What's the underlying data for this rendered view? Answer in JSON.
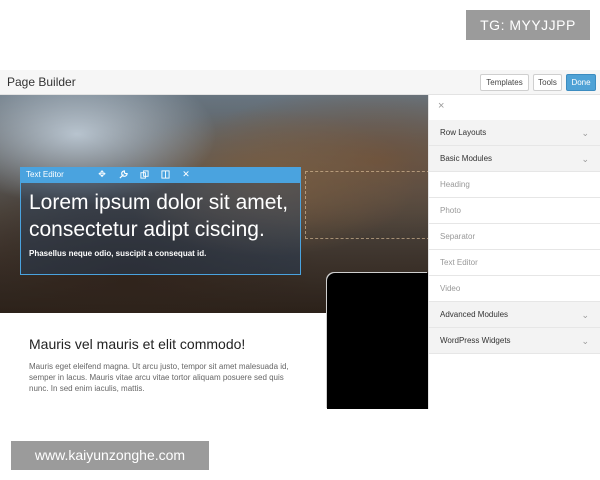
{
  "tg_badge": "TG: MYYJJPP",
  "topbar": {
    "title": "Page Builder",
    "templates_label": "Templates",
    "tools_label": "Tools",
    "done_label": "Done"
  },
  "editor": {
    "tab_label": "Text Editor",
    "heading": "Lorem ipsum dolor sit amet, consectetur adipt ciscing.",
    "subtext": "Phasellus neque odio, suscipit a consequat id."
  },
  "content": {
    "heading": "Mauris vel mauris et elit commodo!",
    "paragraph": "Mauris eget eleifend magna. Ut arcu justo, tempor sit amet malesuada id, semper in lacus. Mauris vitae arcu vitae tortor aliquam posuere sed quis nunc. In sed enim iaculis, mattis."
  },
  "sidebar": {
    "close_icon": "×",
    "items": [
      {
        "label": "Row Layouts",
        "kind": "group"
      },
      {
        "label": "Basic Modules",
        "kind": "group"
      },
      {
        "label": "Heading",
        "kind": "sub"
      },
      {
        "label": "Photo",
        "kind": "sub"
      },
      {
        "label": "Separator",
        "kind": "sub"
      },
      {
        "label": "Text Editor",
        "kind": "sub"
      },
      {
        "label": "Video",
        "kind": "sub"
      },
      {
        "label": "Advanced Modules",
        "kind": "group"
      },
      {
        "label": "WordPress Widgets",
        "kind": "group"
      }
    ]
  },
  "watermark": "www.kaiyunzonghe.com",
  "colors": {
    "accent": "#4aa3df",
    "done_button": "#4fa2d6"
  }
}
